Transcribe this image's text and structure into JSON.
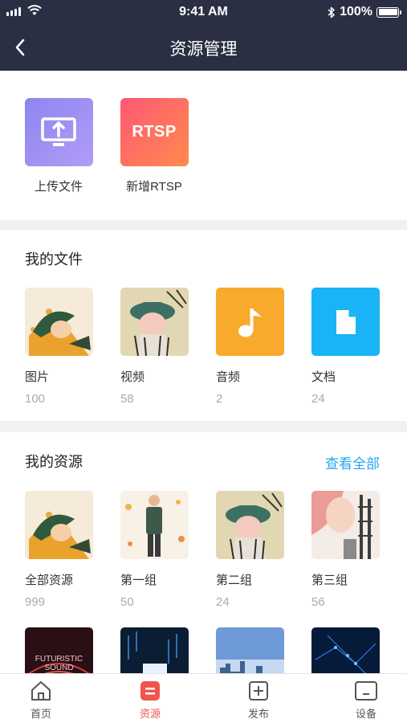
{
  "status_bar": {
    "time": "9:41 AM",
    "battery": "100%"
  },
  "nav": {
    "title": "资源管理"
  },
  "actions": [
    {
      "label": "上传文件",
      "icon": "upload-monitor-icon",
      "color": "#8d86f0"
    },
    {
      "label": "新增RTSP",
      "badge": "RTSP",
      "color": "#ff5873"
    }
  ],
  "my_files": {
    "title": "我的文件",
    "items": [
      {
        "label": "图片",
        "count": "100"
      },
      {
        "label": "视频",
        "count": "58"
      },
      {
        "label": "音频",
        "count": "2",
        "icon": "music-note-icon",
        "color": "#f7aa2c"
      },
      {
        "label": "文档",
        "count": "24",
        "icon": "document-icon",
        "color": "#19b4f5"
      }
    ]
  },
  "my_resources": {
    "title": "我的资源",
    "view_all": "查看全部",
    "items": [
      {
        "label": "全部资源",
        "count": "999"
      },
      {
        "label": "第一组",
        "count": "50"
      },
      {
        "label": "第二组",
        "count": "24"
      },
      {
        "label": "第三组",
        "count": "56"
      }
    ],
    "second_row_thumb_texts": [
      "FUTURISTIC",
      "SOUND"
    ]
  },
  "tabs": [
    {
      "label": "首页",
      "icon": "home-icon"
    },
    {
      "label": "资源",
      "icon": "resource-icon",
      "active": true,
      "color": "#f0544c"
    },
    {
      "label": "发布",
      "icon": "publish-plus-icon"
    },
    {
      "label": "设备",
      "icon": "device-icon"
    }
  ]
}
